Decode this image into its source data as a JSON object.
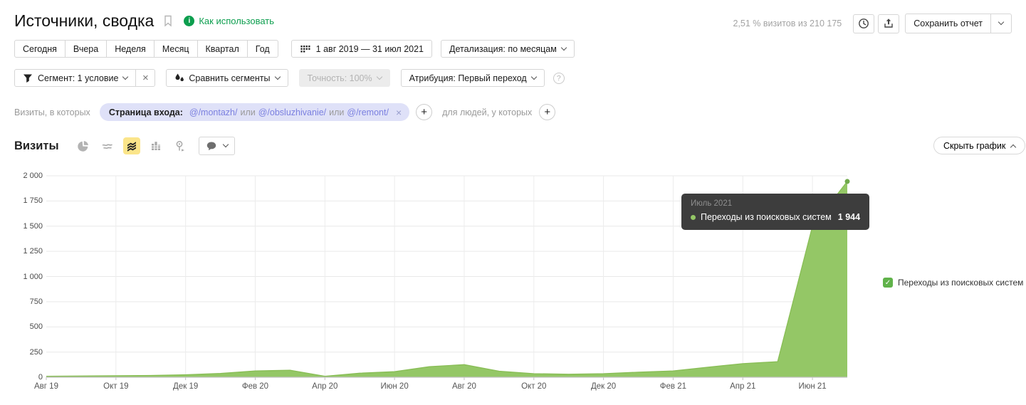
{
  "header": {
    "title": "Источники, сводка",
    "how_to_use": "Как использовать",
    "sample_info": "2,51 % визитов из 210 175",
    "save_report": "Сохранить отчет"
  },
  "period_bar": {
    "presets": [
      "Сегодня",
      "Вчера",
      "Неделя",
      "Месяц",
      "Квартал",
      "Год"
    ],
    "date_range": "1 авг 2019 — 31 июл 2021",
    "detalization": "Детализация: по месяцам"
  },
  "segment_bar": {
    "segment": "Сегмент: 1 условие",
    "compare": "Сравнить сегменты",
    "accuracy": "Точность: 100%",
    "attribution": "Атрибуция: Первый переход"
  },
  "filter_bar": {
    "visits_label": "Визиты, в которых",
    "chip": {
      "prefix": "Страница входа:",
      "parts": [
        {
          "text": "@/montazh/",
          "type": "value"
        },
        {
          "text": "или",
          "type": "op"
        },
        {
          "text": "@/obsluzhivanie/",
          "type": "value"
        },
        {
          "text": "или",
          "type": "op"
        },
        {
          "text": "@/remont/",
          "type": "value"
        }
      ],
      "remove_label": "×"
    },
    "people_label": "для людей, у которых",
    "plus_label": "+"
  },
  "chart_header": {
    "title": "Визиты",
    "hide_chart": "Скрыть график"
  },
  "tooltip": {
    "title": "Июль 2021",
    "series": "Переходы из поисковых систем",
    "value": "1 944"
  },
  "legend": {
    "check_glyph": "✓",
    "label": "Переходы из поисковых систем"
  },
  "colors": {
    "accent_green": "#0c9e4e",
    "area_fill": "#94c766",
    "area_stroke": "#88bd55",
    "point_dot": "#70a94b",
    "selected_icon_bg": "#fbe58a",
    "chip_bg": "#dfe1f8",
    "chip_value_text": "#7b80e0",
    "tooltip_bg": "#3d3d3d",
    "legend_check": "#60b24a"
  },
  "icons": [
    "bookmark-icon",
    "info-icon",
    "clock-icon",
    "export-icon",
    "calendar-icon",
    "filter-funnel-icon",
    "compare-drops-icon",
    "help-icon",
    "pie-chart-icon",
    "line-chart-icon",
    "area-chart-icon",
    "bar-chart-icon",
    "map-pin-icon",
    "comment-icon",
    "chevron-down-icon",
    "chevron-up-icon",
    "close-icon",
    "plus-icon",
    "checkbox-checked-icon"
  ],
  "chart_data": {
    "type": "area",
    "title": "Визиты",
    "x_range": "Авг 2019 — Июл 2021",
    "points_interval": "месяц",
    "ylim": [
      0,
      2000
    ],
    "y_ticks": [
      0,
      250,
      500,
      750,
      1000,
      1250,
      1500,
      1750,
      2000
    ],
    "y_tick_labels": [
      "0",
      "250",
      "500",
      "750",
      "1 000",
      "1 250",
      "1 500",
      "1 750",
      "2 000"
    ],
    "x_tick_labels": [
      "Авг 19",
      "Окт 19",
      "Дек 19",
      "Фев 20",
      "Апр 20",
      "Июн 20",
      "Авг 20",
      "Окт 20",
      "Дек 20",
      "Фев 21",
      "Апр 21",
      "Июн 21"
    ],
    "x_tick_every_n_points": 2,
    "grid": true,
    "legend_position": "right",
    "series": [
      {
        "name": "Переходы из поисковых систем",
        "color": "#94c766",
        "values": [
          10,
          12,
          15,
          18,
          25,
          38,
          62,
          70,
          10,
          40,
          55,
          105,
          125,
          60,
          35,
          30,
          35,
          50,
          62,
          100,
          135,
          155,
          1500,
          1944
        ]
      }
    ],
    "highlight_point": {
      "x_label": "Июль 2021",
      "value": 1944
    }
  }
}
